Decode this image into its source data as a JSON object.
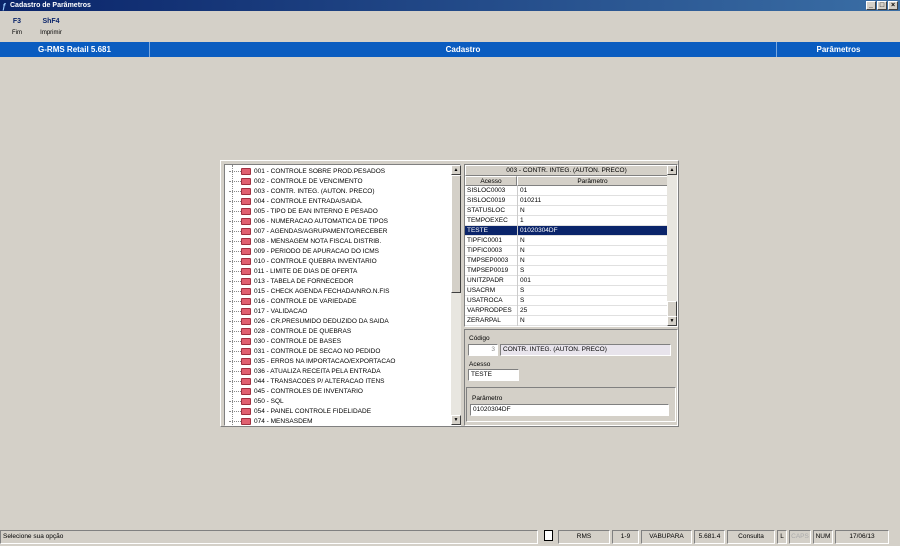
{
  "window": {
    "title": "Cadastro de Parâmetros"
  },
  "toolbar": [
    {
      "key": "F3",
      "label": "Fim"
    },
    {
      "key": "ShF4",
      "label": "Imprimir"
    }
  ],
  "header": {
    "app": "G-RMS Retail 5.681",
    "module": "Cadastro",
    "section": "Parâmetros"
  },
  "tree": {
    "items": [
      "001 - CONTROLE SOBRE PROD.PESADOS",
      "002 - CONTROLE DE VENCIMENTO",
      "003 - CONTR. INTEG. (AUTON. PRECO)",
      "004 - CONTROLE ENTRADA/SAIDA.",
      "005 - TIPO DE EAN INTERNO E PESADO",
      "006 - NUMERACAO AUTOMATICA DE TIPOS",
      "007 - AGENDAS/AGRUPAMENTO/RECEBER",
      "008 - MENSAGEM NOTA FISCAL DISTRIB.",
      "009 - PERIODO DE APURACAO DO ICMS",
      "010 - CONTROLE QUEBRA INVENTARIO",
      "011 - LIMITE DE DIAS DE OFERTA",
      "013 - TABELA DE FORNECEDOR",
      "015 - CHECK AGENDA FECHADA/NRO.N.FIS",
      "016 - CONTROLE DE VARIEDADE",
      "017 - VALIDACAO",
      "026 - CR.PRESUMIDO DEDUZIDO DA SAIDA",
      "028 - CONTROLE DE QUEBRAS",
      "030 - CONTROLE DE BASES",
      "031 - CONTROLE DE SECAO NO PEDIDO",
      "035 - ERROS NA IMPORTACAO/EXPORTACAO",
      "036 - ATUALIZA RECEITA PELA ENTRADA",
      "044 - TRANSACOES P/ ALTERACAO ITENS",
      "045 - CONTROLES DE INVENTARIO",
      "050 - SQL",
      "054 - PAINEL CONTROLE FIDELIDADE",
      "074 - MENSASDEM"
    ]
  },
  "grid": {
    "title": "003 - CONTR. INTEG. (AUTON. PRECO)",
    "columns": [
      "Acesso",
      "Parâmetro"
    ],
    "selected_index": 4,
    "rows": [
      [
        "SISLOC0003",
        "01"
      ],
      [
        "SISLOC0019",
        "010211"
      ],
      [
        "STATUSLOC",
        "N"
      ],
      [
        "TEMPOEXEC",
        "1"
      ],
      [
        "TESTE",
        "01020304DF"
      ],
      [
        "TIPFIC0001",
        "N"
      ],
      [
        "TIPFIC0003",
        "N"
      ],
      [
        "TMPSEP0003",
        "N"
      ],
      [
        "TMPSEP0019",
        "S"
      ],
      [
        "UNITZPADR",
        "001"
      ],
      [
        "USACRM",
        "S"
      ],
      [
        "USATROCA",
        "S"
      ],
      [
        "VARPRODPES",
        "25"
      ],
      [
        "ZERARPAL",
        "N"
      ]
    ]
  },
  "form": {
    "codigo_label": "Código",
    "codigo_value": "3",
    "codigo_desc": "CONTR. INTEG. (AUTON. PRECO)",
    "acesso_label": "Acesso",
    "acesso_value": "TESTE",
    "parametro_label": "Parâmetro",
    "parametro_value": "01020304DF"
  },
  "status": {
    "message": "Selecione sua opção",
    "fields": [
      "RMS",
      "1-9",
      "VABUPARA",
      "5.681.4",
      "Consulta",
      "L",
      "CAPS",
      "NUM",
      "17/06/13"
    ]
  }
}
